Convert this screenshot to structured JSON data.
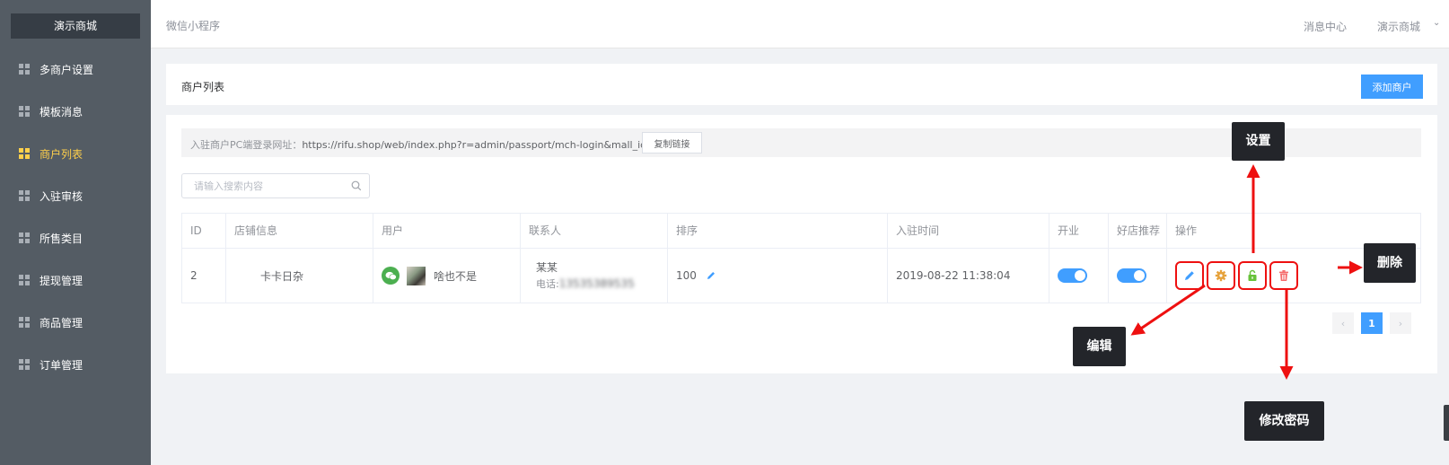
{
  "sidebar": {
    "brand": "演示商城",
    "items": [
      {
        "label": "多商户设置",
        "active": false
      },
      {
        "label": "模板消息",
        "active": false
      },
      {
        "label": "商户列表",
        "active": true
      },
      {
        "label": "入驻审核",
        "active": false
      },
      {
        "label": "所售类目",
        "active": false
      },
      {
        "label": "提现管理",
        "active": false
      },
      {
        "label": "商品管理",
        "active": false
      },
      {
        "label": "订单管理",
        "active": false
      }
    ]
  },
  "header": {
    "title": "微信小程序",
    "message_center": "消息中心",
    "mall_menu": "演示商城"
  },
  "merchant_list": {
    "title": "商户列表",
    "add_button": "添加商户",
    "url_label": "入驻商户PC端登录网址：",
    "url": "https://rifu.shop/web/index.php?r=admin/passport/mch-login&mall_id=3",
    "copy_button": "复制链接",
    "search_placeholder": "请输入搜索内容",
    "columns": [
      "ID",
      "店铺信息",
      "用户",
      "联系人",
      "排序",
      "入驻时间",
      "开业",
      "好店推荐",
      "操作"
    ],
    "rows": [
      {
        "id": "2",
        "shop": "卡卡日杂",
        "user": "啥也不是",
        "contact_name": "某某",
        "contact_phone_label": "电话:",
        "contact_phone": "13535389535",
        "sort": "100",
        "joined_at": "2019-08-22 11:38:04",
        "open": true,
        "recommended": true
      }
    ],
    "pagination": {
      "current": "1",
      "prev": "‹",
      "next": "›"
    }
  },
  "annotations": {
    "settings": "设置",
    "delete": "删除",
    "edit": "编辑",
    "change_password": "修改密码"
  },
  "colors": {
    "sidebar_bg": "#545c64",
    "active_nav": "#ffd04b",
    "primary": "#409eff",
    "edit_btn": "#409eff",
    "settings_btn": "#e6a23c",
    "lock_btn": "#67c23a",
    "delete_btn": "#f56c6c",
    "annotation_arrow": "#ee1010"
  }
}
